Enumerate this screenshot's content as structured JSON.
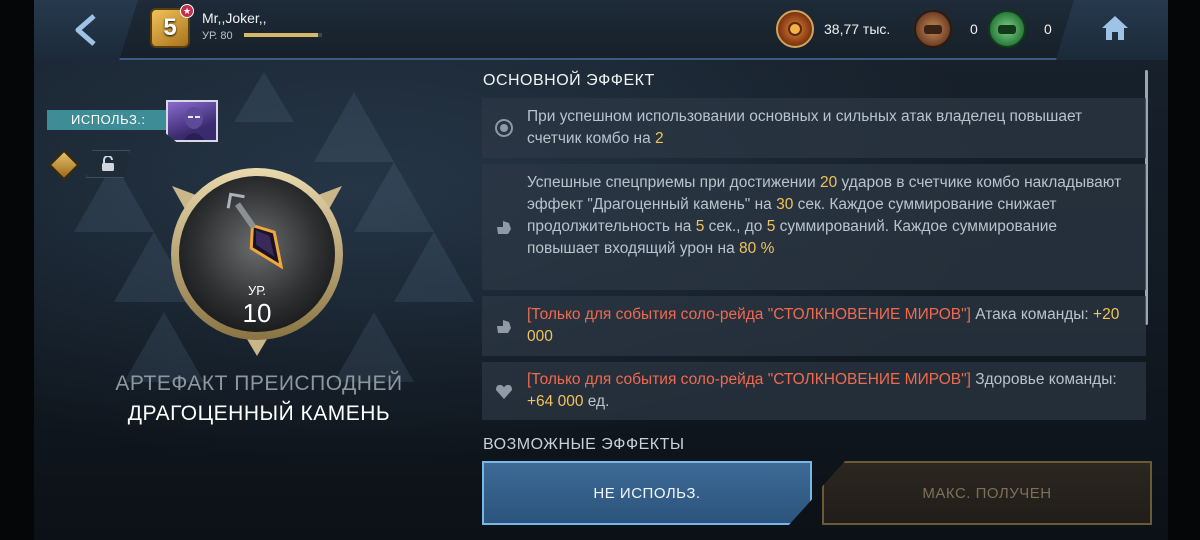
{
  "player": {
    "name": "Mr,,Joker,,",
    "level_text": "УР. 80",
    "xp_fraction": 0.95,
    "badge_number": "5"
  },
  "currencies": [
    {
      "icon": "gold-medal-icon",
      "value": "38,77 тыс."
    },
    {
      "icon": "bronze-token-icon",
      "value": "0"
    },
    {
      "icon": "green-token-icon",
      "value": "0"
    }
  ],
  "artifact": {
    "used_label": "ИСПОЛЬЗ.:",
    "level_label": "УР.",
    "level_value": "10",
    "type_name": "АРТЕФАКТ ПРЕИСПОДНЕЙ",
    "name": "ДРАГОЦЕННЫЙ КАМЕНЬ"
  },
  "effects": {
    "main_title": "ОСНОВНОЙ ЭФФЕКТ",
    "possible_title": "ВОЗМОЖНЫЕ ЭФФЕКТЫ",
    "items": [
      {
        "icon": "combo-icon",
        "parts": [
          {
            "t": "При успешном использовании основных и сильных атак владелец повышает счетчик комбо на ",
            "c": "n"
          },
          {
            "t": "2",
            "c": "hl"
          }
        ]
      },
      {
        "icon": "fist-icon",
        "parts": [
          {
            "t": "Успешные спецприемы при достижении ",
            "c": "n"
          },
          {
            "t": "20",
            "c": "hl"
          },
          {
            "t": " ударов в счетчике комбо накладывают эффект \"Драгоценный камень\" на ",
            "c": "n"
          },
          {
            "t": "30",
            "c": "hl"
          },
          {
            "t": " сек. Каждое суммирование снижает продолжительность на ",
            "c": "n"
          },
          {
            "t": "5",
            "c": "hl"
          },
          {
            "t": " сек., до ",
            "c": "n"
          },
          {
            "t": "5",
            "c": "hl"
          },
          {
            "t": " суммирований. Каждое суммирование повышает входящий урон на ",
            "c": "n"
          },
          {
            "t": "80 %",
            "c": "hl"
          }
        ]
      },
      {
        "icon": "fist-icon",
        "parts": [
          {
            "t": "[Только для события соло-рейда \"СТОЛКНОВЕНИЕ МИРОВ\"]",
            "c": "red"
          },
          {
            "t": " Атака команды: ",
            "c": "n"
          },
          {
            "t": "+20 000",
            "c": "hl"
          }
        ]
      },
      {
        "icon": "heart-icon",
        "parts": [
          {
            "t": "[Только для события соло-рейда \"СТОЛКНОВЕНИЕ МИРОВ\"]",
            "c": "red"
          },
          {
            "t": " Здоровье команды: ",
            "c": "n"
          },
          {
            "t": "+64 000",
            "c": "hl"
          },
          {
            "t": " ед.",
            "c": "n"
          }
        ]
      }
    ]
  },
  "buttons": {
    "unused": "НЕ ИСПОЛЬЗ.",
    "max": "МАКС. ПОЛУЧЕН"
  },
  "colors": {
    "accent_blue": "#77b7e6",
    "highlight": "#f0c35c",
    "raid_red": "#f06a50",
    "used_tag": "#3e8c96"
  }
}
